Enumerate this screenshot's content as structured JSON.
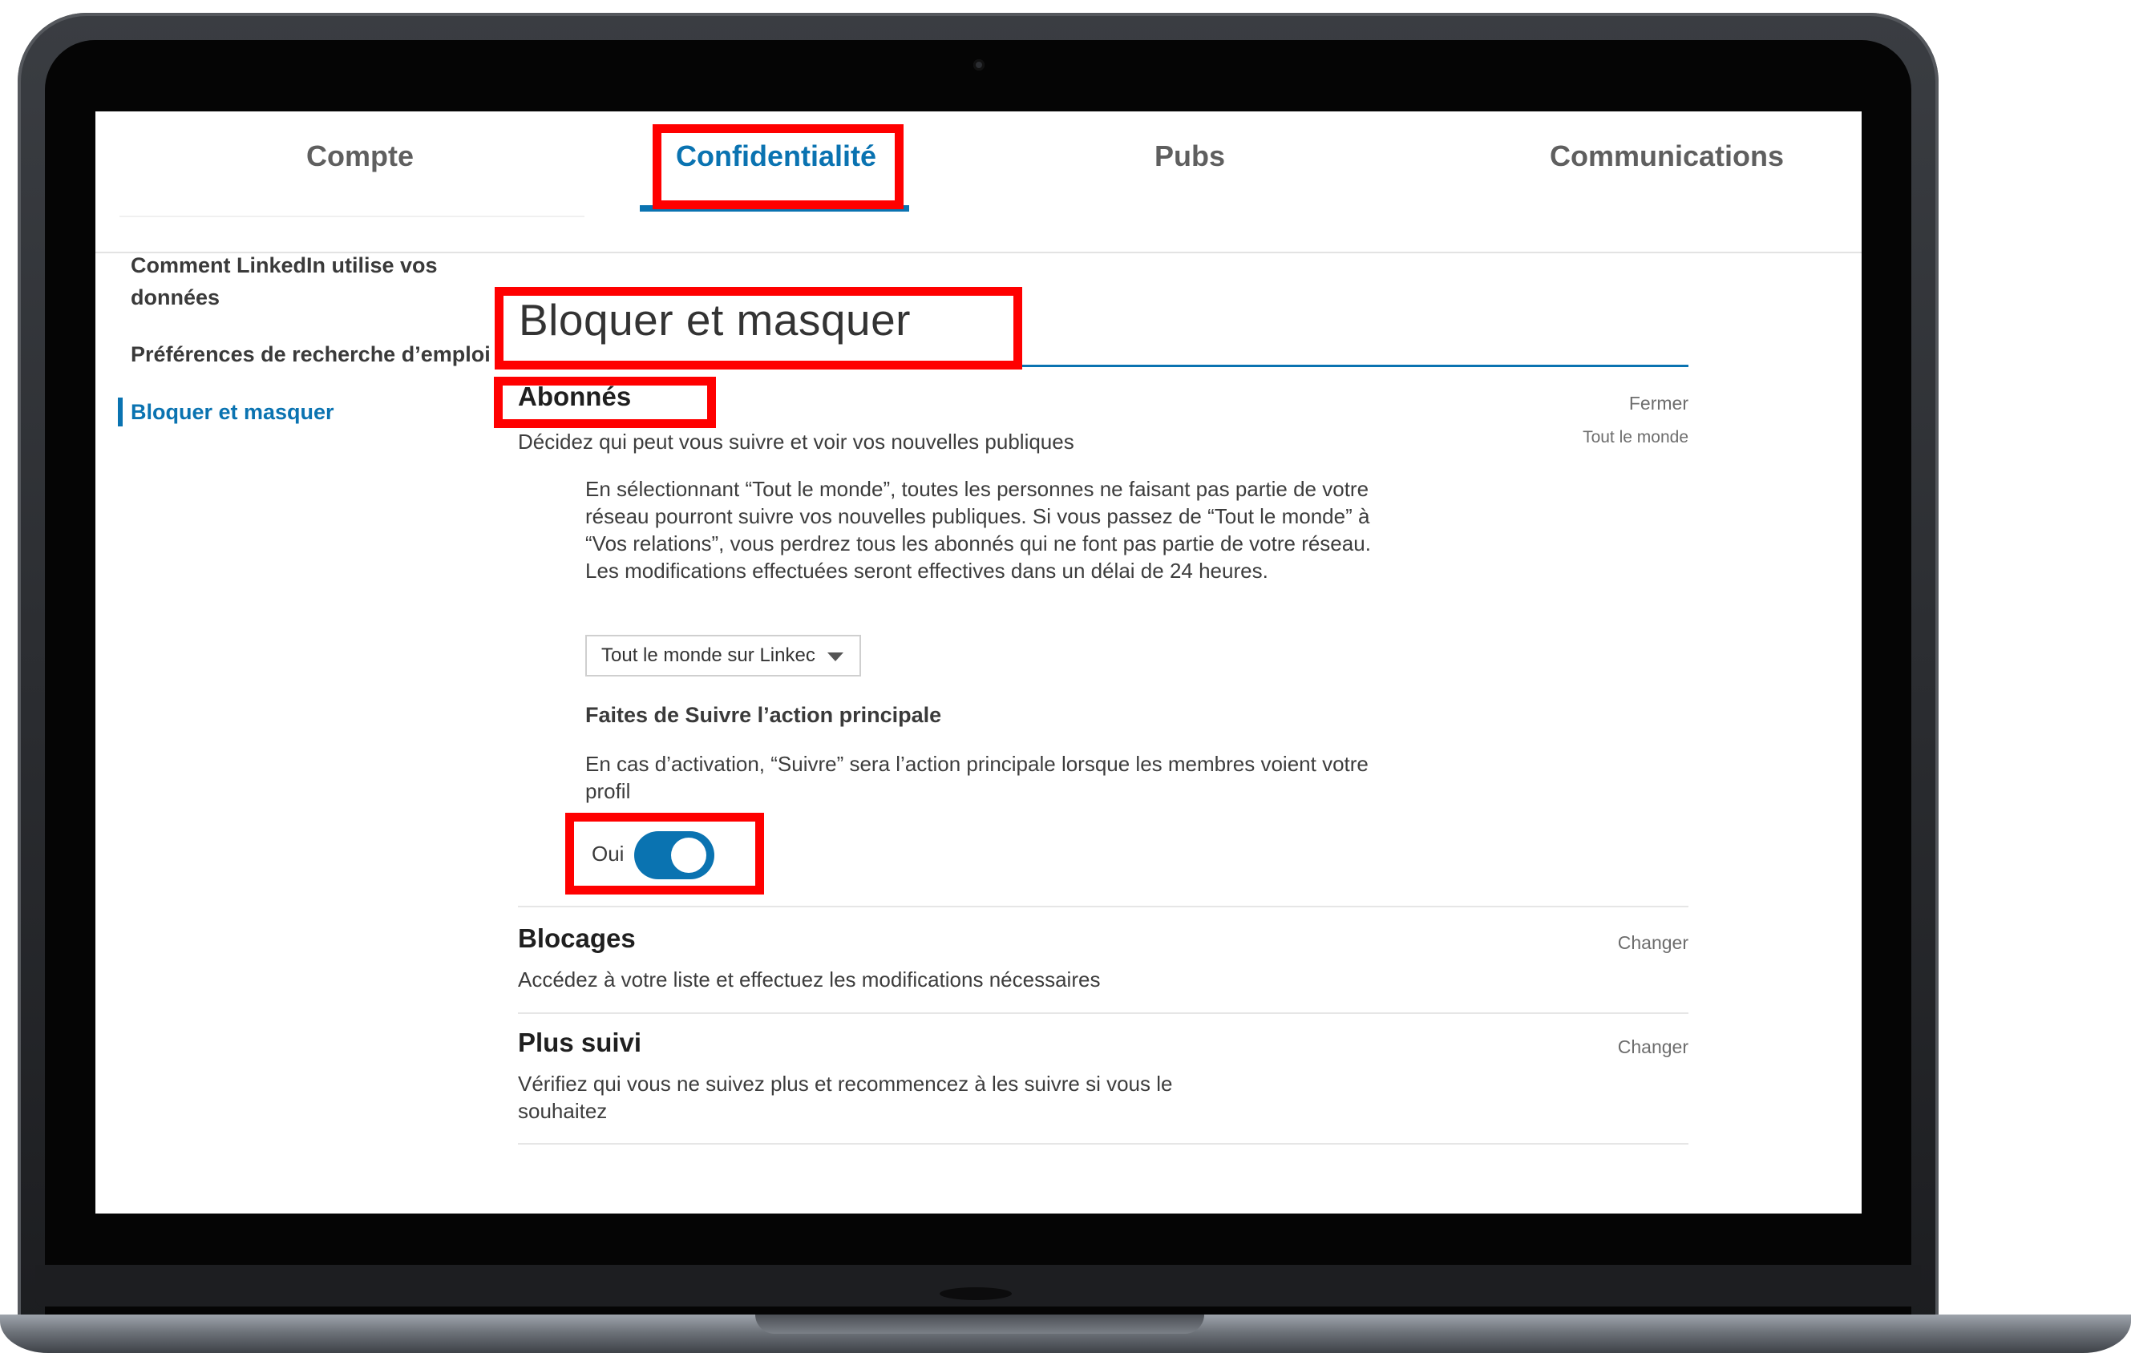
{
  "tabs": [
    {
      "label": "Compte"
    },
    {
      "label": "Confidentialité"
    },
    {
      "label": "Pubs"
    },
    {
      "label": "Communications"
    }
  ],
  "active_tab": "Confidentialité",
  "sidebar": {
    "items": [
      {
        "label": "Comment LinkedIn utilise vos données",
        "line1": "Comment LinkedIn utilise vos",
        "line2": "données"
      },
      {
        "label": "Préférences de recherche d’emploi"
      },
      {
        "label": "Bloquer et masquer"
      }
    ]
  },
  "page": {
    "title": "Bloquer et masquer"
  },
  "followers": {
    "title": "Abonnés",
    "description": "Décidez qui peut vous suivre et voir vos nouvelles publiques",
    "action": "Fermer",
    "current_value": "Tout le monde",
    "info": "En sélectionnant “Tout le monde”, toutes les personnes ne faisant pas partie de votre réseau pourront suivre vos nouvelles publiques. Si vous passez de “Tout le monde” à “Vos relations”, vous perdrez tous les abonnés qui ne font pas partie de votre réseau. Les modifications effectuées seront effectives dans un délai de 24 heures.",
    "select_value": "Tout le monde sur Linkec",
    "follow_primary_heading": "Faites de Suivre l’action principale",
    "follow_primary_text": "En cas d’activation, “Suivre” sera l’action principale lorsque les membres voient votre profil",
    "toggle_label": "Oui",
    "toggle_on": true
  },
  "blocking": {
    "title": "Blocages",
    "description": "Accédez à votre liste et effectuez les modifications nécessaires",
    "action": "Changer"
  },
  "unfollowed": {
    "title": "Plus suivi",
    "description": "Vérifiez qui vous ne suivez plus et recommencez à les suivre si vous le souhaitez",
    "action": "Changer"
  },
  "colors": {
    "accent": "#0a73b1",
    "highlight": "#ff0000"
  }
}
